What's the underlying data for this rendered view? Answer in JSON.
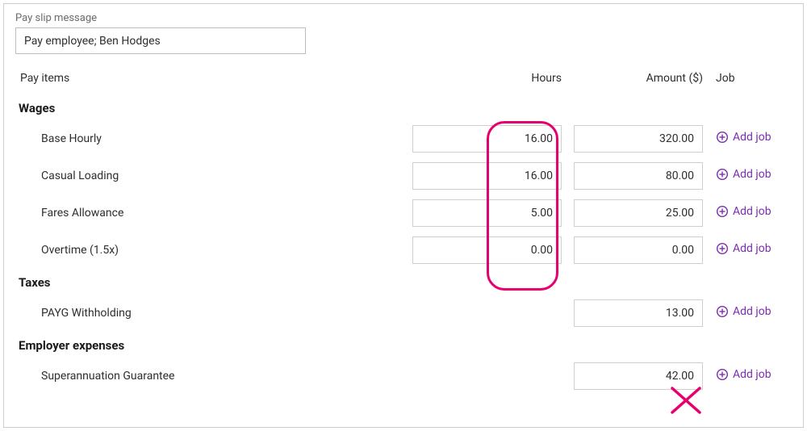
{
  "payslip": {
    "label": "Pay slip message",
    "value": "Pay employee; Ben Hodges"
  },
  "headers": {
    "pay_items": "Pay items",
    "hours": "Hours",
    "amount": "Amount ($)",
    "job": "Job"
  },
  "add_job_label": "Add job",
  "sections": {
    "wages": {
      "title": "Wages",
      "rows": [
        {
          "name": "Base Hourly",
          "hours": "16.00",
          "amount": "320.00"
        },
        {
          "name": "Casual Loading",
          "hours": "16.00",
          "amount": "80.00"
        },
        {
          "name": "Fares Allowance",
          "hours": "5.00",
          "amount": "25.00"
        },
        {
          "name": "Overtime (1.5x)",
          "hours": "0.00",
          "amount": "0.00"
        }
      ]
    },
    "taxes": {
      "title": "Taxes",
      "rows": [
        {
          "name": "PAYG Withholding",
          "amount": "13.00"
        }
      ]
    },
    "employer_expenses": {
      "title": "Employer expenses",
      "rows": [
        {
          "name": "Superannuation Guarantee",
          "amount": "42.00"
        }
      ]
    }
  }
}
